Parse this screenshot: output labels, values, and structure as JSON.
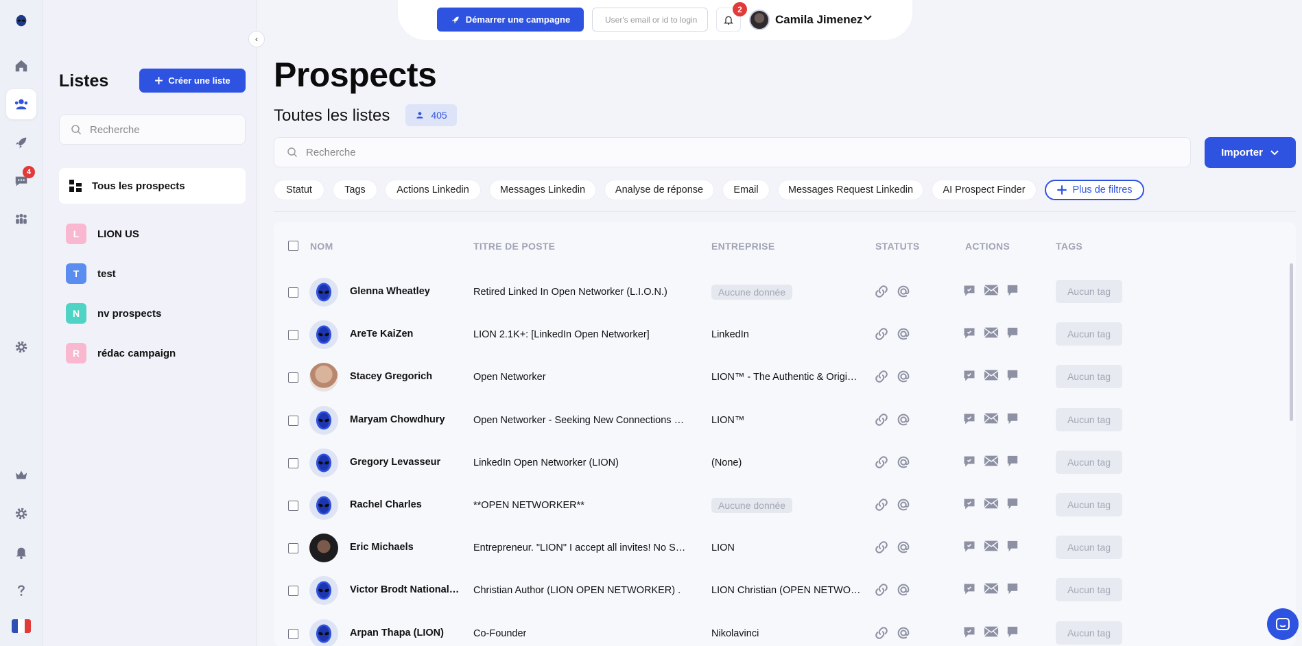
{
  "rail": {
    "items": [
      {
        "icon": "logo-alien-icon"
      },
      {
        "icon": "home-icon"
      },
      {
        "icon": "users-icon",
        "active": true
      },
      {
        "icon": "rocket-icon"
      },
      {
        "icon": "chat-icon",
        "badge": "4"
      },
      {
        "icon": "team-icon"
      },
      {
        "icon": "settings-icon"
      },
      {
        "icon": "crown-icon"
      },
      {
        "icon": "settings-icon"
      },
      {
        "icon": "bell-icon"
      },
      {
        "icon": "help-icon"
      },
      {
        "icon": "flag-fr-icon"
      }
    ],
    "chat_badge": "4"
  },
  "lists_panel": {
    "title": "Listes",
    "create_label": "Créer une liste",
    "search_placeholder": "Recherche",
    "all_label": "Tous les prospects",
    "items": [
      {
        "letter": "L",
        "label": "LION US",
        "color": "#f9b8d0"
      },
      {
        "letter": "T",
        "label": "test",
        "color": "#5b8cf0"
      },
      {
        "letter": "N",
        "label": "nv prospects",
        "color": "#4fd3c4"
      },
      {
        "letter": "R",
        "label": "rédac campaign",
        "color": "#f9b8d0"
      }
    ]
  },
  "topbar": {
    "campaign_label": "Démarrer une campagne",
    "login_placeholder": "User's email or id to login",
    "notif_count": "2",
    "user_name": "Camila Jimenez"
  },
  "main": {
    "title": "Prospects",
    "subtitle": "Toutes les listes",
    "count": "405",
    "search_placeholder": "Recherche",
    "import_label": "Importer",
    "filters": [
      "Statut",
      "Tags",
      "Actions Linkedin",
      "Messages Linkedin",
      "Analyse de réponse",
      "Email",
      "Messages Request Linkedin",
      "AI Prospect Finder"
    ],
    "more_filters_label": "Plus de filtres"
  },
  "table": {
    "headers": {
      "name": "NOM",
      "title": "TITRE DE POSTE",
      "company": "ENTREPRISE",
      "status": "STATUTS",
      "actions": "ACTIONS",
      "tags": "TAGS"
    },
    "rows": [
      {
        "name": "Glenna Wheatley",
        "title": "Retired Linked In Open Networker (L.I.O.N.)",
        "company": "Aucune donnée",
        "company_empty": true,
        "avatar": "alien",
        "tag": "Aucun tag"
      },
      {
        "name": "AreTe KaiZen",
        "title": "LION 2.1K+: [LinkedIn Open Networker]",
        "company": "LinkedIn",
        "company_empty": false,
        "avatar": "alien",
        "tag": "Aucun tag"
      },
      {
        "name": "Stacey Gregorich",
        "title": "Open Networker",
        "company": "LION™ - The Authentic & Original Network",
        "company_empty": false,
        "avatar": "photo1",
        "tag": "Aucun tag"
      },
      {
        "name": "Maryam Chowdhury",
        "title": "Open Networker - Seeking New Connections & Opportunities",
        "company": "LION™",
        "company_empty": false,
        "avatar": "alien",
        "tag": "Aucun tag"
      },
      {
        "name": "Gregory Levasseur",
        "title": "LinkedIn Open Networker (LION)",
        "company": "(None)",
        "company_empty": false,
        "avatar": "alien",
        "tag": "Aucun tag"
      },
      {
        "name": "Rachel Charles",
        "title": "**OPEN NETWORKER**",
        "company": "Aucune donnée",
        "company_empty": true,
        "avatar": "alien",
        "tag": "Aucun tag"
      },
      {
        "name": "Eric Michaels",
        "title": "Entrepreneur. \"LION\" I accept all invites! No Spam Please",
        "company": "LION",
        "company_empty": false,
        "avatar": "photo2",
        "tag": "Aucun tag"
      },
      {
        "name": "Victor Brodt Nationally Acclaimed",
        "title": "Christian Author (LION OPEN NETWORKER) .",
        "company": "LION Christian (OPEN NETWORKER)",
        "company_empty": false,
        "avatar": "alien",
        "tag": "Aucun tag"
      },
      {
        "name": "Arpan Thapa (LION)",
        "title": "Co-Founder",
        "company": "Nikolavinci",
        "company_empty": false,
        "avatar": "alien",
        "tag": "Aucun tag"
      }
    ]
  },
  "colors": {
    "primary": "#2f53e1",
    "badge": "#e03a3a",
    "icon_grey": "#8d91a3"
  }
}
